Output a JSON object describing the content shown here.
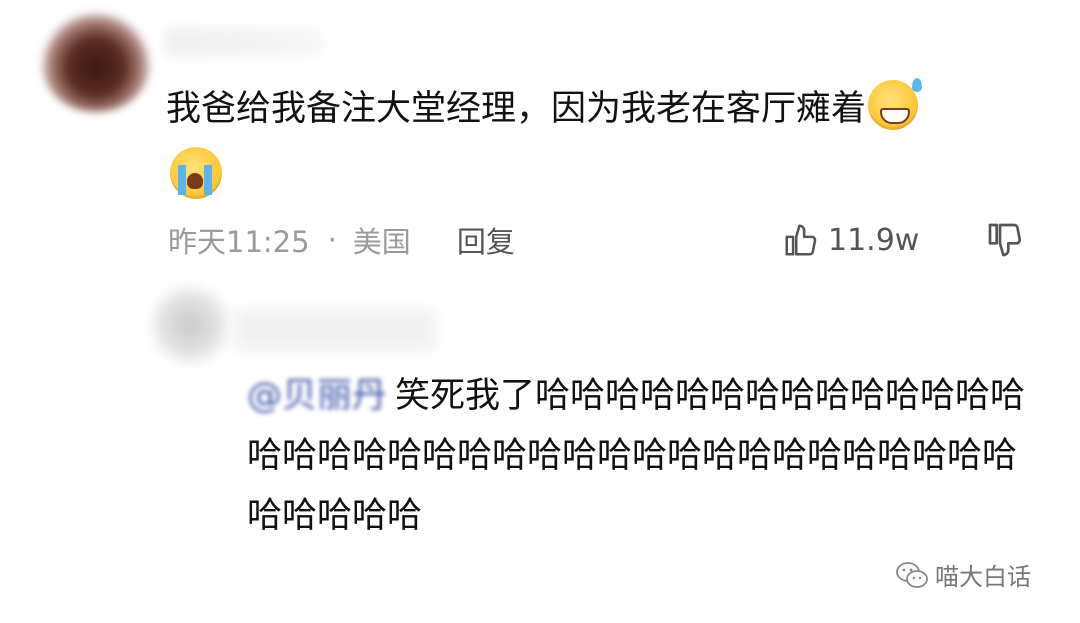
{
  "comment": {
    "text": "我爸给我备注大堂经理，因为我老在客厅瘫着",
    "emoji_after_text": "sweat-smile-emoji",
    "emoji_line2": "crying-face-emoji",
    "time": "昨天11:25",
    "separator": "·",
    "location": "美国",
    "reply_label": "回复",
    "like_count": "11.9w"
  },
  "reply": {
    "mention": "@贝丽丹",
    "text": "笑死我了哈哈哈哈哈哈哈哈哈哈哈哈哈哈哈哈哈哈哈哈哈哈哈哈哈哈哈哈哈哈哈哈哈哈哈哈哈哈哈哈哈"
  },
  "watermark": {
    "text": "喵大白话",
    "icon": "wechat-icon"
  },
  "colors": {
    "meta_gray": "#9a9a9a",
    "mention_blue": "#3b57a8",
    "emoji_yellow": "#ffc83a"
  }
}
